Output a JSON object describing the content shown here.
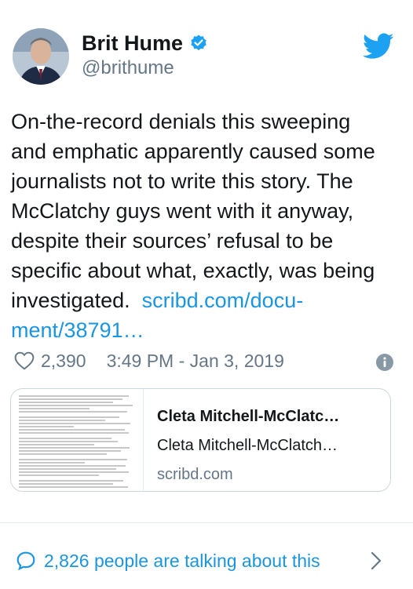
{
  "author": {
    "name": "Brit Hume",
    "handle": "@brithume",
    "avatar_icon": "profile-photo"
  },
  "tweet": {
    "lines": [
      "On-the-record denials this sweeping",
      "and emphatic apparently caused some",
      "journalists not to write this story. The",
      "McClatchy guys went with it anyway,",
      "despite their sources’ refusal to be",
      "specific about what, exactly, was being",
      "investigated."
    ],
    "link_part1": "scribd.com/docu-",
    "link_part2": "ment/38791…"
  },
  "meta": {
    "likes": "2,390",
    "timestamp": "3:49 PM - Jan 3, 2019"
  },
  "link_card": {
    "title": "Cleta Mitchell-McClatc…",
    "description": "Cleta Mitchell-McClatch…",
    "domain": "scribd.com"
  },
  "footer": {
    "talking_text": "2,826 people are talking about this"
  },
  "colors": {
    "accent": "#1b95e0",
    "muted": "#657786",
    "border": "#ccd6dd"
  }
}
